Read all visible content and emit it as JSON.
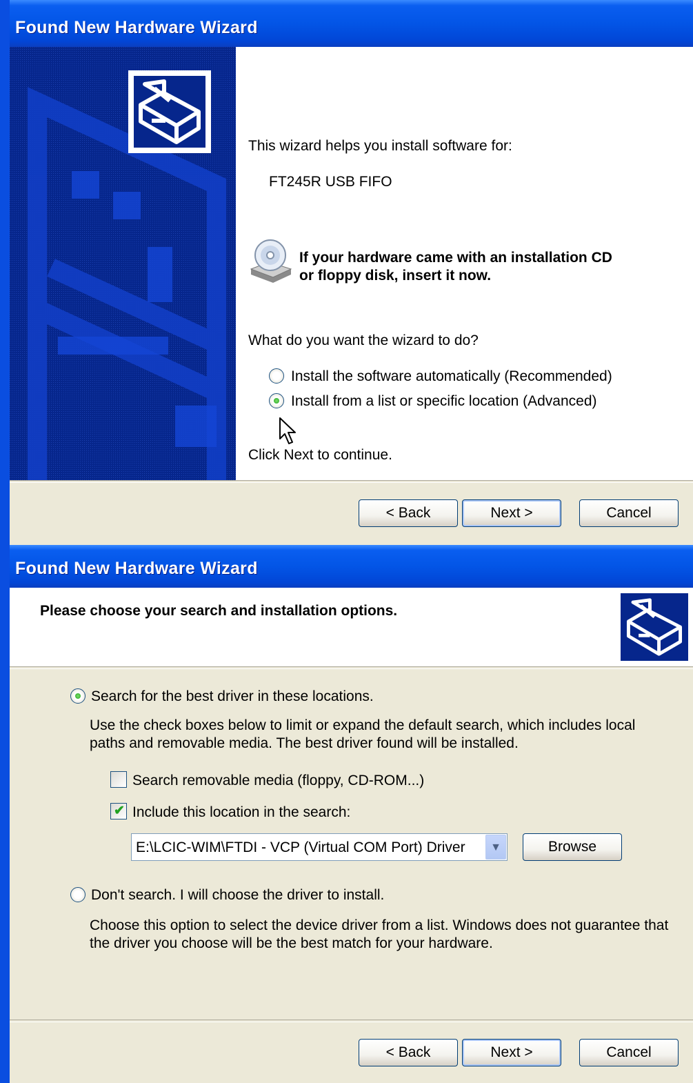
{
  "window1": {
    "title": "Found New Hardware Wizard",
    "intro": "This wizard helps you install software for:",
    "device": "FT245R USB FIFO",
    "cd_notice_line1": "If your hardware came with an installation CD",
    "cd_notice_line2": "or floppy disk, insert it now.",
    "question": "What do you want the wizard to do?",
    "options": [
      {
        "label": "Install the software automatically (Recommended)",
        "selected": false
      },
      {
        "label": "Install from a list or specific location (Advanced)",
        "selected": true
      }
    ],
    "hint": "Click Next to continue.",
    "buttons": {
      "back": "< Back",
      "next": "Next >",
      "cancel": "Cancel"
    }
  },
  "window2": {
    "title": "Found New Hardware Wizard",
    "heading": "Please choose your search and installation options.",
    "search_option": {
      "label": "Search for the best driver in these locations.",
      "selected": true,
      "description_line1": "Use the check boxes below to limit or expand the default search, which includes local",
      "description_line2": "paths and removable media. The best driver found will be installed."
    },
    "checkboxes": [
      {
        "label": "Search removable media (floppy, CD-ROM...)",
        "checked": false
      },
      {
        "label": "Include this location in the search:",
        "checked": true
      }
    ],
    "location_value": "E:\\LCIC-WIM\\FTDI - VCP (Virtual COM Port) Driver",
    "browse_label": "Browse",
    "dont_search_option": {
      "label": "Don't search. I will choose the driver to install.",
      "selected": false,
      "description_line1": "Choose this option to select the device driver from a list.  Windows does not guarantee that",
      "description_line2": "the driver you choose will be the best match for your hardware."
    },
    "buttons": {
      "back": "< Back",
      "next": "Next >",
      "cancel": "Cancel"
    }
  },
  "colors": {
    "titlebar": "#0355e6",
    "dialog_bg": "#ece9d8",
    "side_panel": "#06268c",
    "radio_dot": "#21a121"
  },
  "icons": [
    "hardware-board-icon",
    "cd-drive-icon",
    "mouse-cursor-icon",
    "dropdown-arrow-icon"
  ]
}
